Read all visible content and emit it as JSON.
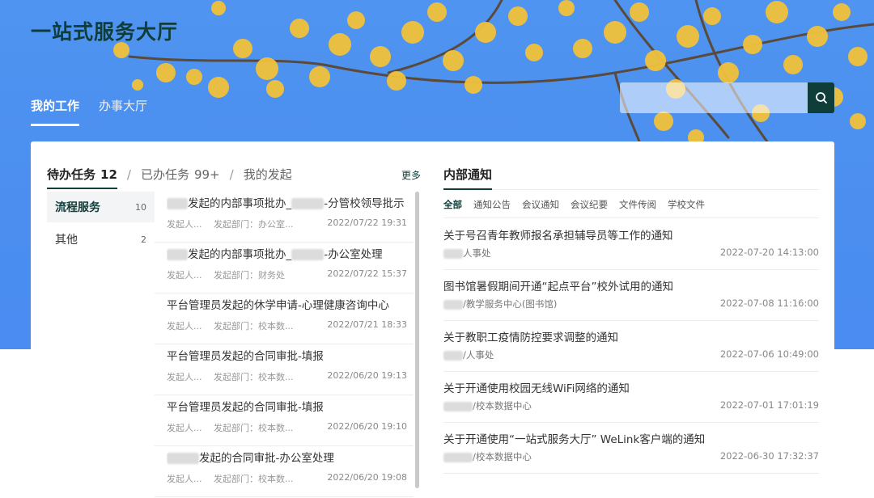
{
  "header": {
    "site_title": "一站式服务大厅",
    "tabs": [
      {
        "label": "我的工作",
        "active": true
      },
      {
        "label": "办事大厅",
        "active": false
      }
    ],
    "search": {
      "value": "",
      "placeholder": "",
      "icon": "search-icon"
    }
  },
  "tasks": {
    "tabs": [
      {
        "label": "待办任务",
        "count": "12",
        "active": true
      },
      {
        "label": "已办任务",
        "count": "99+",
        "active": false
      },
      {
        "label": "我的发起",
        "count": "",
        "active": false
      }
    ],
    "more_label": "更多",
    "categories": [
      {
        "label": "流程服务",
        "count": "10",
        "active": true
      },
      {
        "label": "其他",
        "count": "2",
        "active": false
      }
    ],
    "items": [
      {
        "title_suffix": "发起的内部事项批办_",
        "title_tail": "-分管校领导批示",
        "applicant": "发起人...",
        "dept_label": "发起部门：",
        "dept": "办公室...",
        "time": "2022/07/22 19:31"
      },
      {
        "title_suffix": "发起的内部事项批办_",
        "title_tail": "-办公室处理",
        "applicant": "发起人...",
        "dept_label": "发起部门：",
        "dept": "财务处",
        "time": "2022/07/22 15:37"
      },
      {
        "title": "平台管理员发起的休学申请-心理健康咨询中心",
        "applicant": "发起人...",
        "dept_label": "发起部门：",
        "dept": "校本数...",
        "time": "2022/07/21 18:33"
      },
      {
        "title": "平台管理员发起的合同审批-填报",
        "applicant": "发起人...",
        "dept_label": "发起部门：",
        "dept": "校本数...",
        "time": "2022/06/20 19:13"
      },
      {
        "title": "平台管理员发起的合同审批-填报",
        "applicant": "发起人...",
        "dept_label": "发起部门：",
        "dept": "校本数...",
        "time": "2022/06/20 19:10"
      },
      {
        "title_suffix": "发起的合同审批-办公室处理",
        "applicant": "发起人...",
        "dept_label": "发起部门：",
        "dept": "校本数...",
        "time": "2022/06/20 19:08"
      }
    ]
  },
  "notices": {
    "title": "内部通知",
    "categories": [
      {
        "label": "全部",
        "active": true
      },
      {
        "label": "通知公告",
        "active": false
      },
      {
        "label": "会议通知",
        "active": false
      },
      {
        "label": "会议纪要",
        "active": false
      },
      {
        "label": "文件传阅",
        "active": false
      },
      {
        "label": "学校文件",
        "active": false
      }
    ],
    "items": [
      {
        "title": "关于号召青年教师报名承担辅导员等工作的通知",
        "source": "人事处",
        "time": "2022-07-20 14:13:00"
      },
      {
        "title": "图书馆暑假期间开通“起点平台”校外试用的通知",
        "source": "/教学服务中心(图书馆)",
        "time": "2022-07-08 11:16:00"
      },
      {
        "title": "关于教职工疫情防控要求调整的通知",
        "source": "/人事处",
        "time": "2022-07-06 10:49:00"
      },
      {
        "title": "关于开通使用校园无线WiFi网络的通知",
        "source": "/校本数据中心",
        "time": "2022-07-01 17:01:19"
      },
      {
        "title": "关于开通使用“一站式服务大厅” WeLink客户端的通知",
        "source": "/校本数据中心",
        "time": "2022-06-30 17:32:37"
      }
    ]
  },
  "colors": {
    "banner": "#4b8ef0",
    "accent": "#0f3d3a",
    "leaf": "#f2c23a"
  }
}
